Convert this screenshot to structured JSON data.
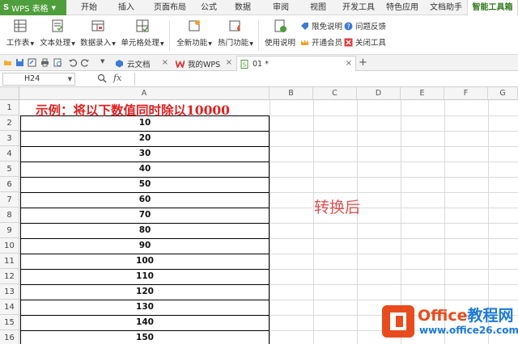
{
  "app": {
    "brand": "WPS 表格",
    "brand_letter": "S"
  },
  "menu": [
    "开始",
    "插入",
    "页面布局",
    "公式",
    "数据",
    "审阅",
    "视图",
    "开发工具",
    "特色应用",
    "文档助手",
    "智能工具箱"
  ],
  "ribbon": {
    "buttons": [
      "工作表",
      "文本处理",
      "数据录入",
      "单元格处理",
      "全新功能",
      "热门功能",
      "使用说明"
    ],
    "small": [
      "限免说明",
      "问题反馈",
      "开通会员",
      "关闭工具"
    ]
  },
  "tabs": [
    {
      "label": "云文档"
    },
    {
      "label": "我的WPS"
    },
    {
      "label": "01 *"
    }
  ],
  "formula_bar": {
    "name_box": "H24",
    "fx": "fx",
    "content": ""
  },
  "columns": [
    "A",
    "B",
    "C",
    "D",
    "E",
    "F",
    "G"
  ],
  "rows": [
    "1",
    "2",
    "3",
    "4",
    "5",
    "6",
    "7",
    "8",
    "9",
    "10",
    "11",
    "12",
    "13",
    "14",
    "15",
    "16"
  ],
  "sheet": {
    "title": "示例：将以下数值同时除以10000",
    "values": [
      "10",
      "20",
      "30",
      "40",
      "50",
      "60",
      "70",
      "80",
      "90",
      "100",
      "110",
      "120",
      "130",
      "140",
      "150"
    ],
    "annotation": "转换后"
  },
  "watermark": {
    "line1a": "Office",
    "line1b": "教程网",
    "line2": "www.office26.com"
  },
  "colors": {
    "brand_green": "#4f9e3c",
    "title_red": "#e02020",
    "annotation_red": "#e05050",
    "wm_orange": "#e84c1e",
    "wm_blue": "#1d7bd8"
  }
}
